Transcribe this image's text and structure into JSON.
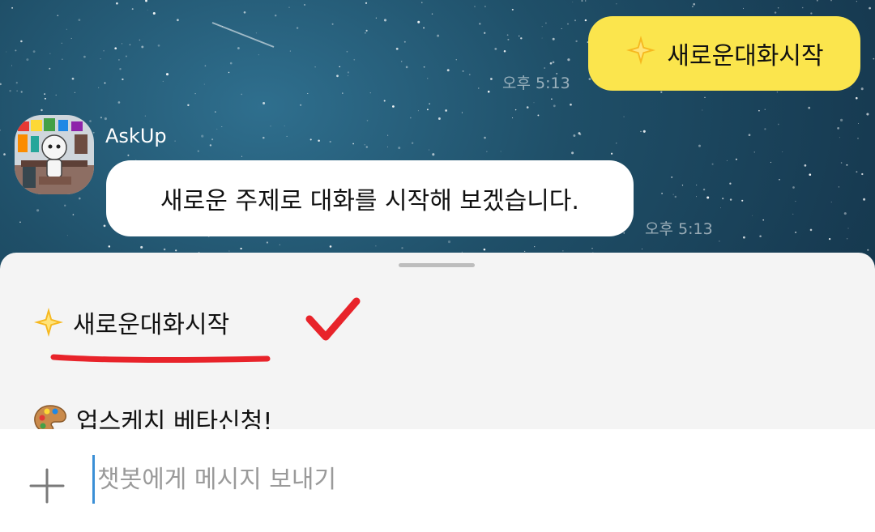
{
  "chat": {
    "my_message": {
      "emoji_icon": "sparkle-icon",
      "text": "새로운대화시작",
      "time": "오후 5:13"
    },
    "bot": {
      "name": "AskUp",
      "avatar_icon": "robot-avatar-icon",
      "message": "새로운 주제로 대화를 시작해 보겠습니다.",
      "time": "오후 5:13"
    }
  },
  "sheet": {
    "options": [
      {
        "emoji_icon": "sparkle-icon",
        "label": "새로운대화시작"
      },
      {
        "emoji_icon": "palette-icon",
        "label": "업스케치 베타신청!"
      }
    ]
  },
  "input_bar": {
    "plus_icon": "plus-icon",
    "placeholder": "챗봇에게 메시지 보내기"
  },
  "colors": {
    "my_bubble": "#fbe54d",
    "bot_bubble": "#ffffff",
    "annotation_red": "#e8232a",
    "caret": "#3a8fd6"
  }
}
